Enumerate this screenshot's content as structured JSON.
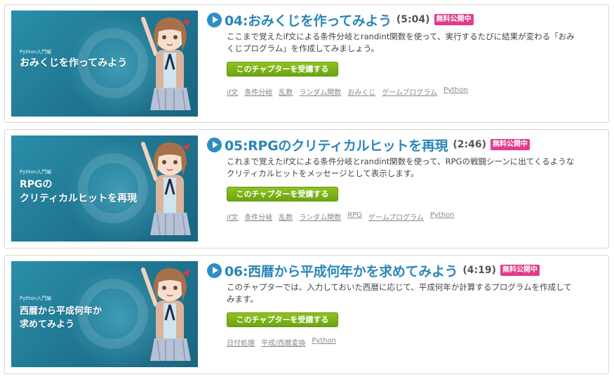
{
  "chapters": [
    {
      "thumbnail": {
        "kicker": "Python入門編",
        "title": "おみくじを作ってみよう"
      },
      "title": "04:おみくじを作ってみよう",
      "duration": "(5:04)",
      "badge": "無料公開中",
      "description": "ここまで覚えたif文による条件分岐とrandint関数を使って、実行するたびに結果が変わる「おみくじプログラム」を作成してみましょう。",
      "cta": "このチャプターを受講する",
      "tags": [
        "if文",
        "条件分岐",
        "乱数",
        "ランダム関数",
        "おみくじ",
        "ゲームプログラム",
        "Python"
      ]
    },
    {
      "thumbnail": {
        "kicker": "Python入門編",
        "title": "RPGの\nクリティカルヒットを再現"
      },
      "title": "05:RPGのクリティカルヒットを再現",
      "duration": "(2:46)",
      "badge": "無料公開中",
      "description": "これまで覚えたif文による条件分岐とrandint関数を使って、RPGの戦闘シーンに出てくるようなクリティカルヒットをメッセージとして表示します。",
      "cta": "このチャプターを受講する",
      "tags": [
        "if文",
        "条件分岐",
        "乱数",
        "ランダム関数",
        "RPG",
        "ゲームプログラム",
        "Python"
      ]
    },
    {
      "thumbnail": {
        "kicker": "Python入門編",
        "title": "西暦から平成何年か\n求めてみよう"
      },
      "title": "06:西暦から平成何年かを求めてみよう",
      "duration": "(4:19)",
      "badge": "無料公開中",
      "description": "このチャプターでは、入力しておいた西暦に応じて、平成何年か計算するプログラムを作成してみます。",
      "cta": "このチャプターを受講する",
      "tags": [
        "日付処理",
        "平成/西暦変換",
        "Python"
      ]
    }
  ],
  "colors": {
    "title": "#2a86b8",
    "badge": "#e13c8c",
    "cta": "#7cb518",
    "thumbnail": "#1f7490"
  },
  "icons": {
    "play": "play-circle-icon"
  }
}
